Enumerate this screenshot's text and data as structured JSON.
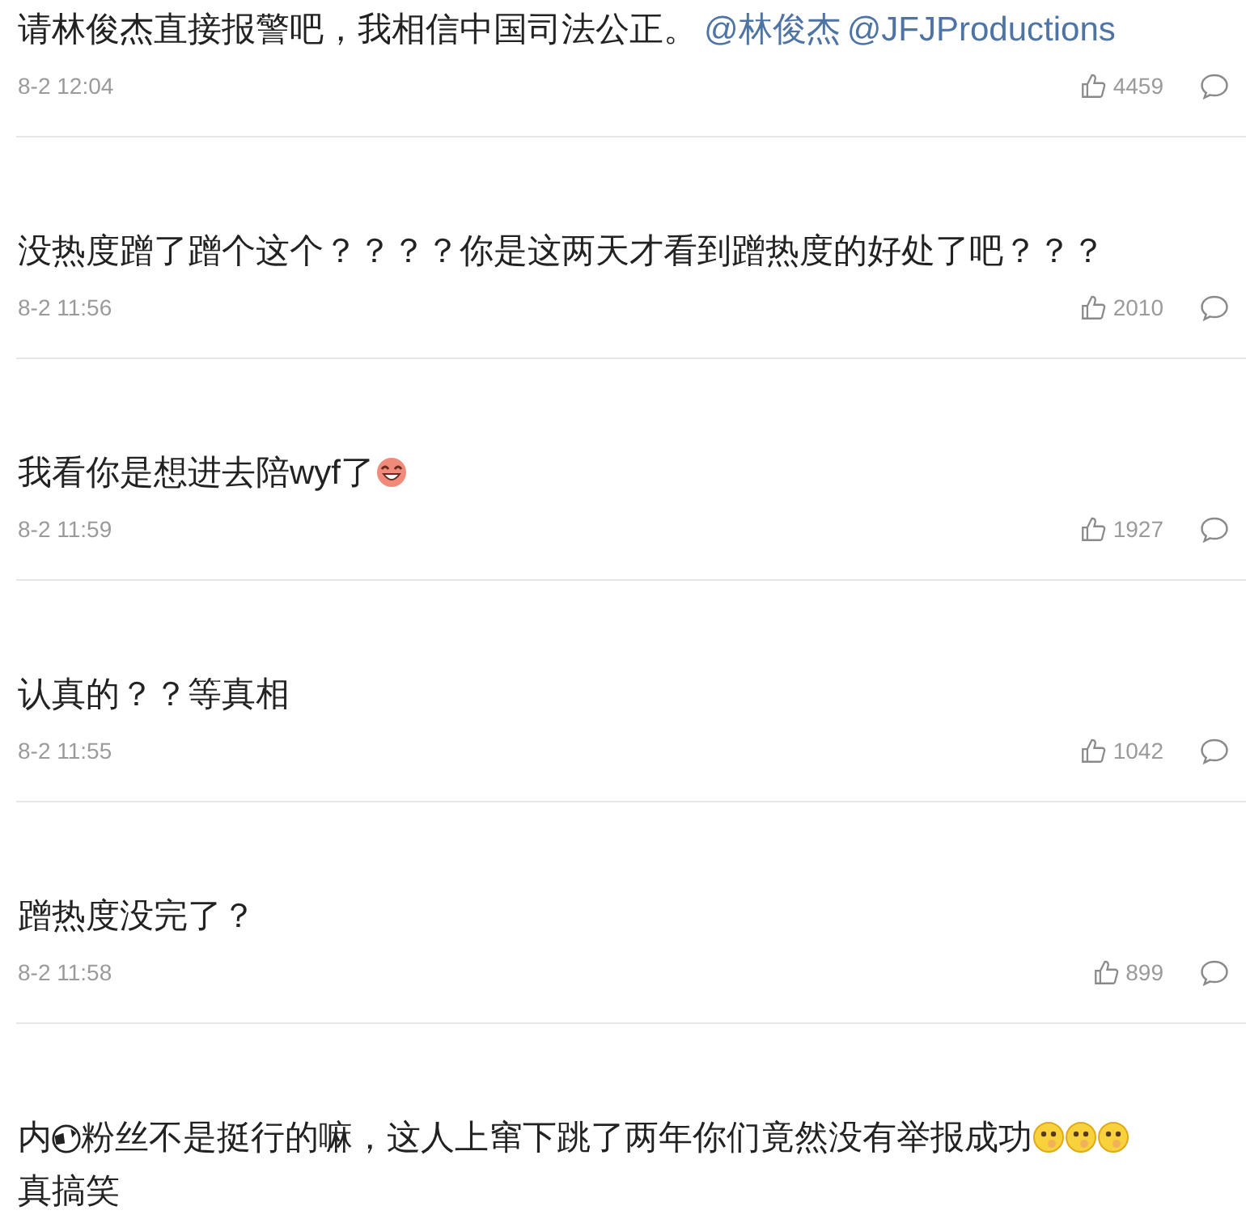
{
  "comments": [
    {
      "body": [
        {
          "kind": "text",
          "text": "请林俊杰直接报警吧，我相信中国司法公正。"
        },
        {
          "kind": "mention",
          "text": "@林俊杰"
        },
        {
          "kind": "mention",
          "text": "@JFJProductions"
        }
      ],
      "time": "8-2 12:04",
      "likes": "4459"
    },
    {
      "body": [
        {
          "kind": "text",
          "text": "没热度蹭了蹭个这个？？？？你是这两天才看到蹭热度的好处了吧？？？"
        }
      ],
      "time": "8-2 11:56",
      "likes": "2010"
    },
    {
      "body": [
        {
          "kind": "text",
          "text": "我看你是想进去陪wyf了"
        },
        {
          "kind": "laugh"
        }
      ],
      "time": "8-2 11:59",
      "likes": "1927"
    },
    {
      "body": [
        {
          "kind": "text",
          "text": "认真的？？等真相"
        }
      ],
      "time": "8-2 11:55",
      "likes": "1042"
    },
    {
      "body": [
        {
          "kind": "text",
          "text": "蹭热度没完了？"
        }
      ],
      "time": "8-2 11:58",
      "likes": "899"
    },
    {
      "body": [
        {
          "kind": "text",
          "text": "内"
        },
        {
          "kind": "ball"
        },
        {
          "kind": "text",
          "text": "粉丝不是挺行的嘛，这人上窜下跳了两年你们竟然没有举报成功"
        },
        {
          "kind": "think"
        },
        {
          "kind": "think"
        },
        {
          "kind": "think"
        },
        {
          "kind": "line",
          "text": "真搞笑"
        }
      ]
    }
  ]
}
